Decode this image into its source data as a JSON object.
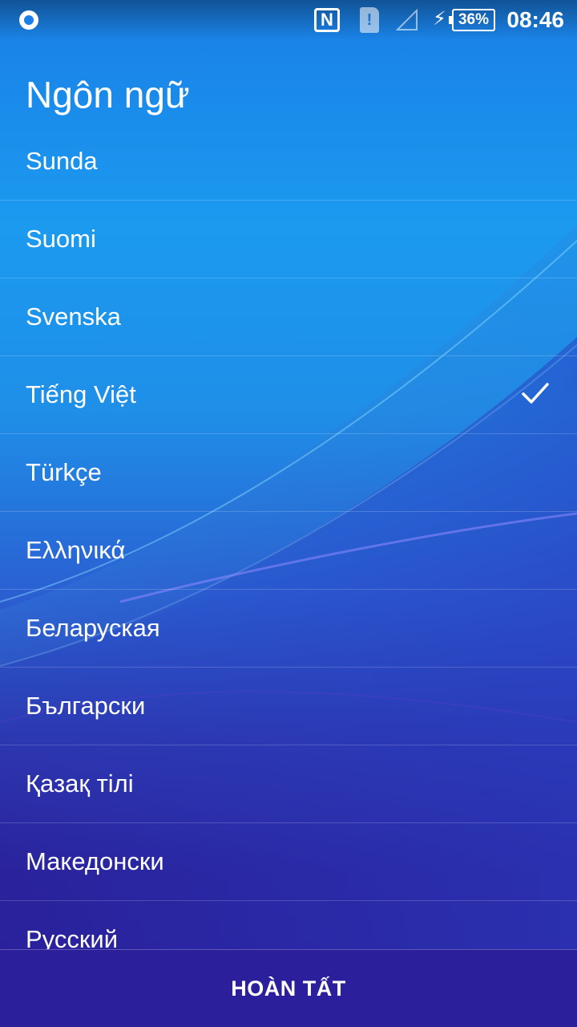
{
  "status_bar": {
    "left_icon": "notification-icon",
    "nfc_icon": "nfc-icon",
    "nfc_text": "N",
    "sim_icon": "sim-alert-icon",
    "sim_text": "!",
    "signal_icon": "signal-empty-icon",
    "charging_icon": "charging-bolt-icon",
    "battery": "36%",
    "time": "08:46"
  },
  "title": "Ngôn ngữ",
  "languages": [
    {
      "label": "Sunda",
      "selected": false
    },
    {
      "label": "Suomi",
      "selected": false
    },
    {
      "label": "Svenska",
      "selected": false
    },
    {
      "label": "Tiếng Việt",
      "selected": true
    },
    {
      "label": "Türkçe",
      "selected": false
    },
    {
      "label": "Ελληνικά",
      "selected": false
    },
    {
      "label": "Беларуская",
      "selected": false
    },
    {
      "label": "Български",
      "selected": false
    },
    {
      "label": "Қазақ тілі",
      "selected": false
    },
    {
      "label": "Македонски",
      "selected": false
    },
    {
      "label": "Русский",
      "selected": false
    }
  ],
  "selected_icon": "check-icon",
  "footer": {
    "done_label": "HOÀN TẤT"
  },
  "colors": {
    "background_top": "#1a7fe6",
    "background_bottom": "#2a1f9a",
    "text": "#ffffff"
  }
}
